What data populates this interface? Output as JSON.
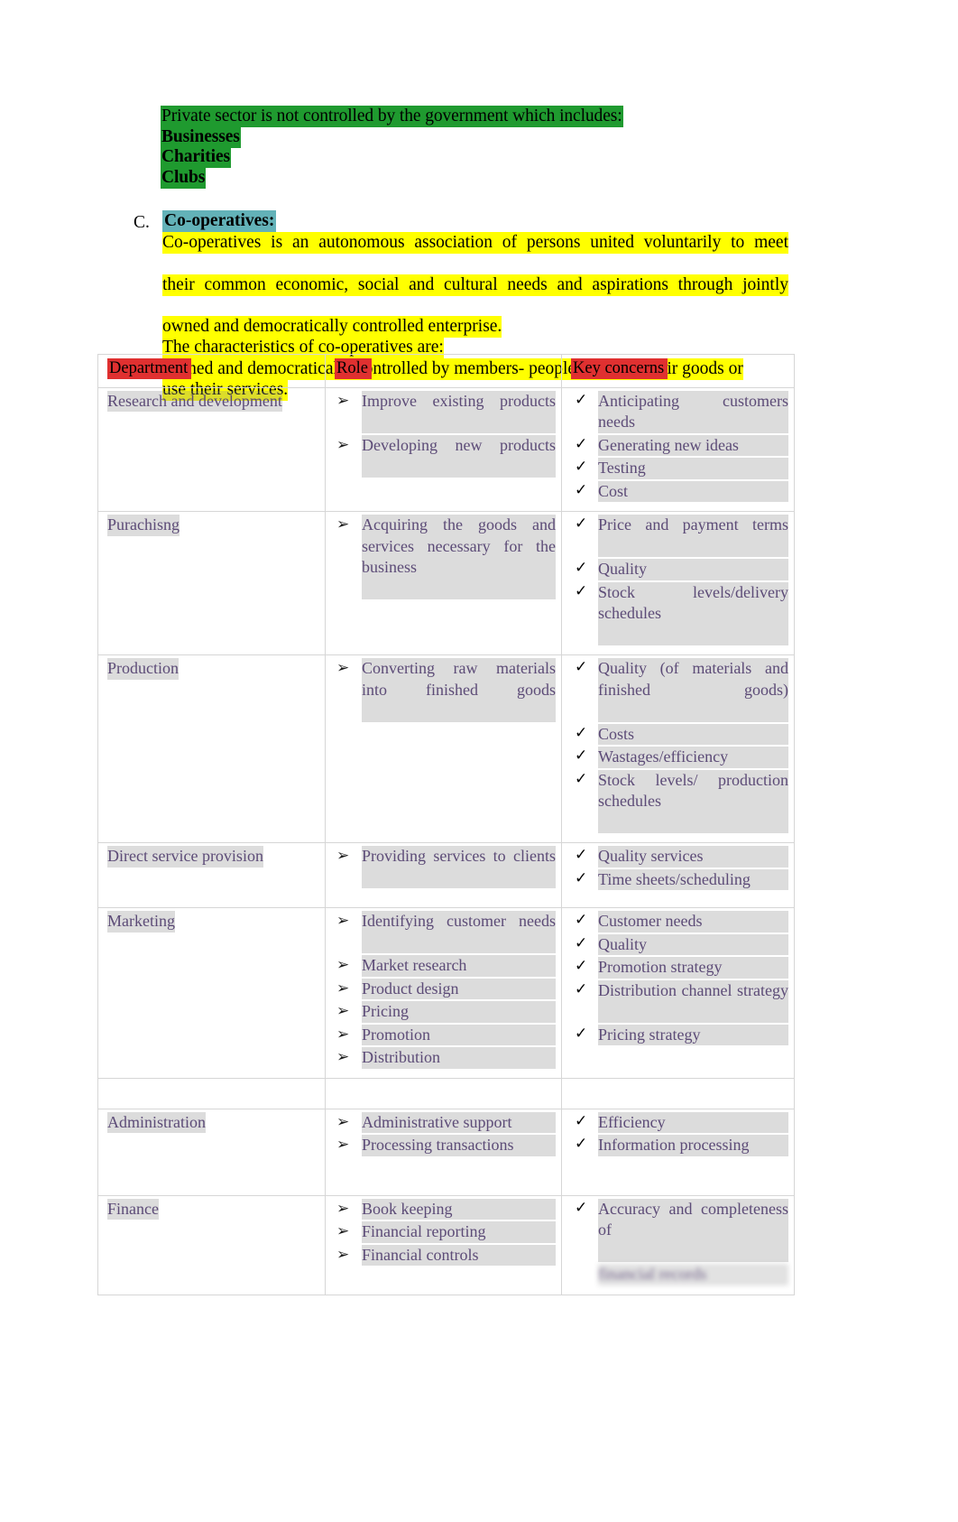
{
  "intro": {
    "lines": [
      {
        "text": "Private sector is not controlled by the government which includes:",
        "highlight": "green",
        "bold": false
      },
      {
        "text": "Businesses",
        "highlight": "green",
        "bold": true
      },
      {
        "text": "Charities",
        "highlight": "green",
        "bold": true
      },
      {
        "text": "Clubs",
        "highlight": "green",
        "bold": true
      }
    ]
  },
  "section_c": {
    "marker": "C.",
    "title": "Co-operatives:",
    "definition_l1": "Co-operatives is an autonomous association of persons united voluntarily to meet",
    "definition_l2": "their common economic, social and cultural needs and aspirations through jointly",
    "definition_l3": "owned and democratically controlled enterprise.",
    "characteristics_heading": "The characteristics of co-operatives are:",
    "characteristic_l1": "Owned and democratically controlled by members- people who  buy their  goods or",
    "characteristic_l2": "use their services."
  },
  "colors": {
    "highlight_green": "#1f9a2f",
    "highlight_yellow": "#ffff00",
    "highlight_teal": "#63b2b8",
    "highlight_red": "#e03030",
    "table_text": "#5c4b77",
    "shade_gray": "rgba(140,140,140,0.30)"
  },
  "table": {
    "headers": [
      "Department",
      "Role",
      "Key concerns"
    ],
    "rows": [
      {
        "department": "Research and development",
        "role": [
          "Improve existing products",
          "Developing new products"
        ],
        "concerns": [
          "Anticipating customers needs",
          "Generating new ideas",
          "Testing",
          "Cost"
        ]
      },
      {
        "department": "Purachisng",
        "role": [
          "Acquiring the goods and services necessary for the business"
        ],
        "concerns": [
          "Price and payment terms",
          "Quality",
          "Stock  levels/delivery schedules"
        ]
      },
      {
        "department": "Production",
        "role": [
          "Converting raw materials into finished goods"
        ],
        "concerns": [
          "Quality (of materials and finished goods)",
          "Costs",
          "Wastages/efficiency",
          "Stock levels/ production schedules"
        ]
      },
      {
        "department": "Direct service  provision",
        "role": [
          "Providing services to clients"
        ],
        "concerns": [
          "Quality services",
          "Time sheets/scheduling"
        ]
      },
      {
        "department": "Marketing",
        "role": [
          "Identifying customer needs",
          "Market research",
          "Product design",
          "Pricing",
          "Promotion",
          "Distribution"
        ],
        "concerns": [
          "Customer needs",
          "Quality",
          "Promotion strategy",
          "Distribution channel strategy",
          "Pricing strategy"
        ]
      },
      {
        "department": "Administration",
        "role": [
          "Administrative support",
          "Processing transactions"
        ],
        "concerns": [
          "Efficiency",
          "Information processing"
        ]
      },
      {
        "department": "Finance",
        "role": [
          "Book keeping",
          "Financial reporting",
          "Financial controls"
        ],
        "concerns": [
          "Accuracy and completeness of",
          "financial records"
        ]
      }
    ]
  },
  "icons": {
    "role_bullet": "➢",
    "concern_bullet": "✓"
  }
}
